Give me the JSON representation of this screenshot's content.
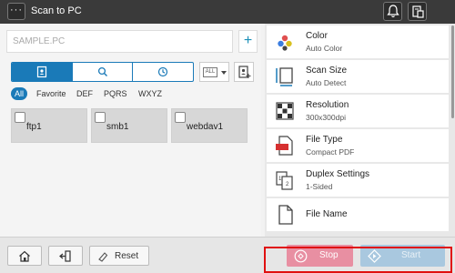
{
  "app": {
    "title": "Scan to PC",
    "menu_glyph": "···"
  },
  "colors": {
    "accent": "#1a7ab8",
    "stop": "#e88fa2",
    "start": "#a9c8df",
    "highlight": "#e01010"
  },
  "header_icons": [
    "bell-icon",
    "device-status-icon"
  ],
  "destination": {
    "placeholder": "SAMPLE.PC",
    "add_label": "+"
  },
  "search_tabs": [
    {
      "icon": "address-book-icon",
      "selected": true
    },
    {
      "icon": "search-icon",
      "selected": false
    },
    {
      "icon": "history-clock-icon",
      "selected": false
    }
  ],
  "filter": {
    "selected": "ALL"
  },
  "index_tabs": [
    {
      "label": "All",
      "active": true
    },
    {
      "label": "Favorite",
      "active": false
    },
    {
      "label": "DEF",
      "active": false
    },
    {
      "label": "PQRS",
      "active": false
    },
    {
      "label": "WXYZ",
      "active": false
    }
  ],
  "destinations": [
    {
      "name": "ftp1",
      "checked": false
    },
    {
      "name": "smb1",
      "checked": false
    },
    {
      "name": "webdav1",
      "checked": false
    }
  ],
  "settings": [
    {
      "name": "Color",
      "value": "Auto Color",
      "icon": "color-icon"
    },
    {
      "name": "Scan Size",
      "value": "Auto Detect",
      "icon": "scan-size-icon"
    },
    {
      "name": "Resolution",
      "value": "300x300dpi",
      "icon": "resolution-icon"
    },
    {
      "name": "File Type",
      "value": "Compact PDF",
      "icon": "pdf-file-icon"
    },
    {
      "name": "Duplex Settings",
      "value": "1-Sided",
      "icon": "duplex-icon"
    },
    {
      "name": "File Name",
      "value": "",
      "icon": "file-name-icon"
    }
  ],
  "bottom": {
    "reset_label": "Reset",
    "stop_label": "Stop",
    "start_label": "Start"
  }
}
